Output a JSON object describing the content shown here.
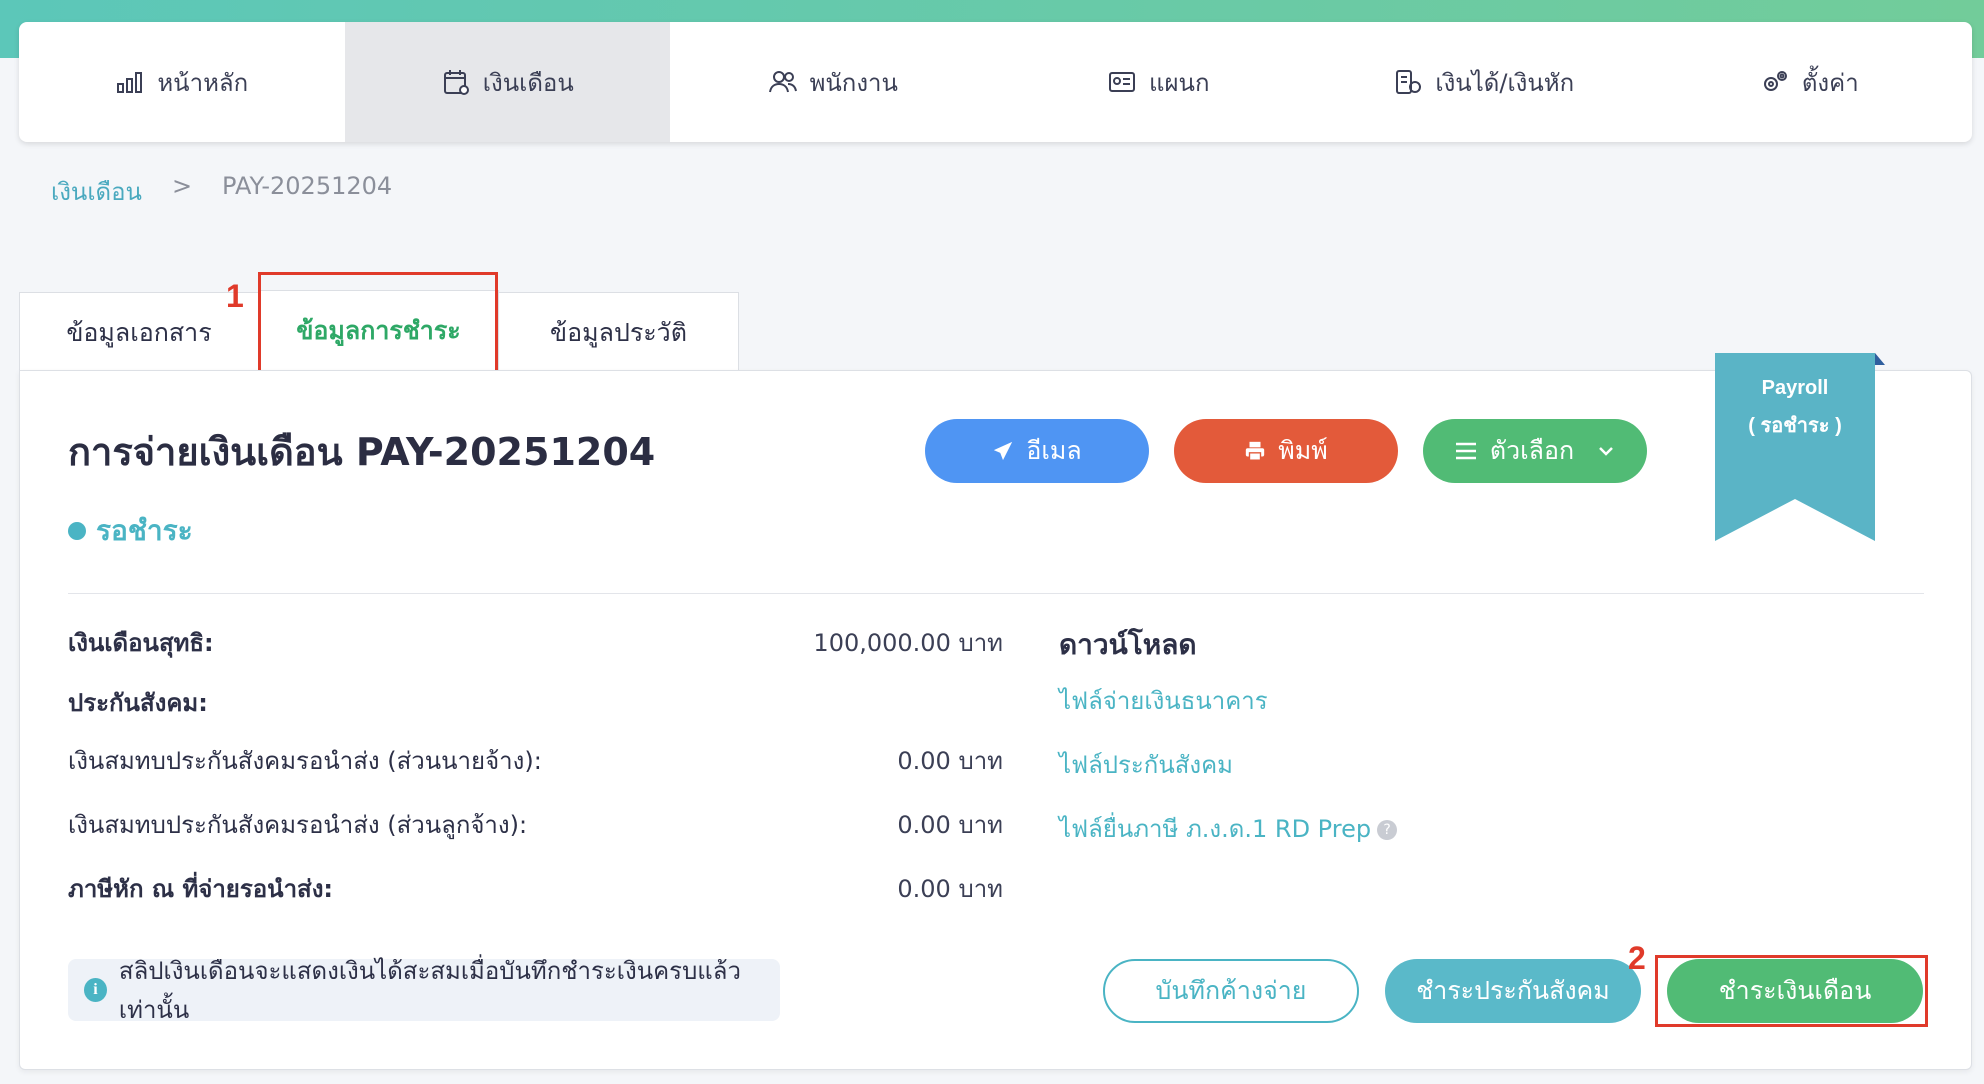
{
  "nav": {
    "items": [
      {
        "label": "หน้าหลัก",
        "icon": "bar-chart-icon"
      },
      {
        "label": "เงินเดือน",
        "icon": "calendar-icon"
      },
      {
        "label": "พนักงาน",
        "icon": "users-icon"
      },
      {
        "label": "แผนก",
        "icon": "id-card-icon"
      },
      {
        "label": "เงินได้/เงินหัก",
        "icon": "coins-icon"
      },
      {
        "label": "ตั้งค่า",
        "icon": "gears-icon"
      }
    ],
    "active_index": 1
  },
  "breadcrumb": {
    "root": "เงินเดือน",
    "separator": ">",
    "current": "PAY-20251204"
  },
  "tabs": [
    {
      "label": "ข้อมูลเอกสาร"
    },
    {
      "label": "ข้อมูลการชำระ"
    },
    {
      "label": "ข้อมูลประวัติ"
    }
  ],
  "annotations": {
    "one": "1",
    "two": "2"
  },
  "document": {
    "title": "การจ่ายเงินเดือน PAY-20251204",
    "status": "รอชำระ",
    "status_color": "#4ab4c4"
  },
  "actions": {
    "email": "อีเมล",
    "print": "พิมพ์",
    "options": "ตัวเลือก"
  },
  "ribbon": {
    "line1": "Payroll",
    "line2": "( รอชำระ )",
    "color": "#5ab4c6"
  },
  "summary": {
    "net_salary_label": "เงินเดือนสุทธิ:",
    "net_salary_value": "100,000.00 บาท",
    "sso_label": "ประกันสังคม:",
    "sso_employer_label": "เงินสมทบประกันสังคมรอนำส่ง (ส่วนนายจ้าง):",
    "sso_employer_value": "0.00 บาท",
    "sso_employee_label": "เงินสมทบประกันสังคมรอนำส่ง (ส่วนลูกจ้าง):",
    "sso_employee_value": "0.00 บาท",
    "wht_label": "ภาษีหัก ณ ที่จ่ายรอนำส่ง:",
    "wht_value": "0.00 บาท"
  },
  "downloads": {
    "title": "ดาวน์โหลด",
    "bank_file": "ไฟล์จ่ายเงินธนาคาร",
    "sso_file": "ไฟล์ประกันสังคม",
    "tax_file": "ไฟล์ยื่นภาษี ภ.ง.ด.1 RD Prep"
  },
  "note": "สลิปเงินเดือนจะแสดงเงินได้สะสมเมื่อบันทึกชำระเงินครบแล้วเท่านั้น",
  "footer_buttons": {
    "save_unpaid": "บันทึกค้างจ่าย",
    "pay_sso": "ชำระประกันสังคม",
    "pay_salary": "ชำระเงินเดือน"
  }
}
